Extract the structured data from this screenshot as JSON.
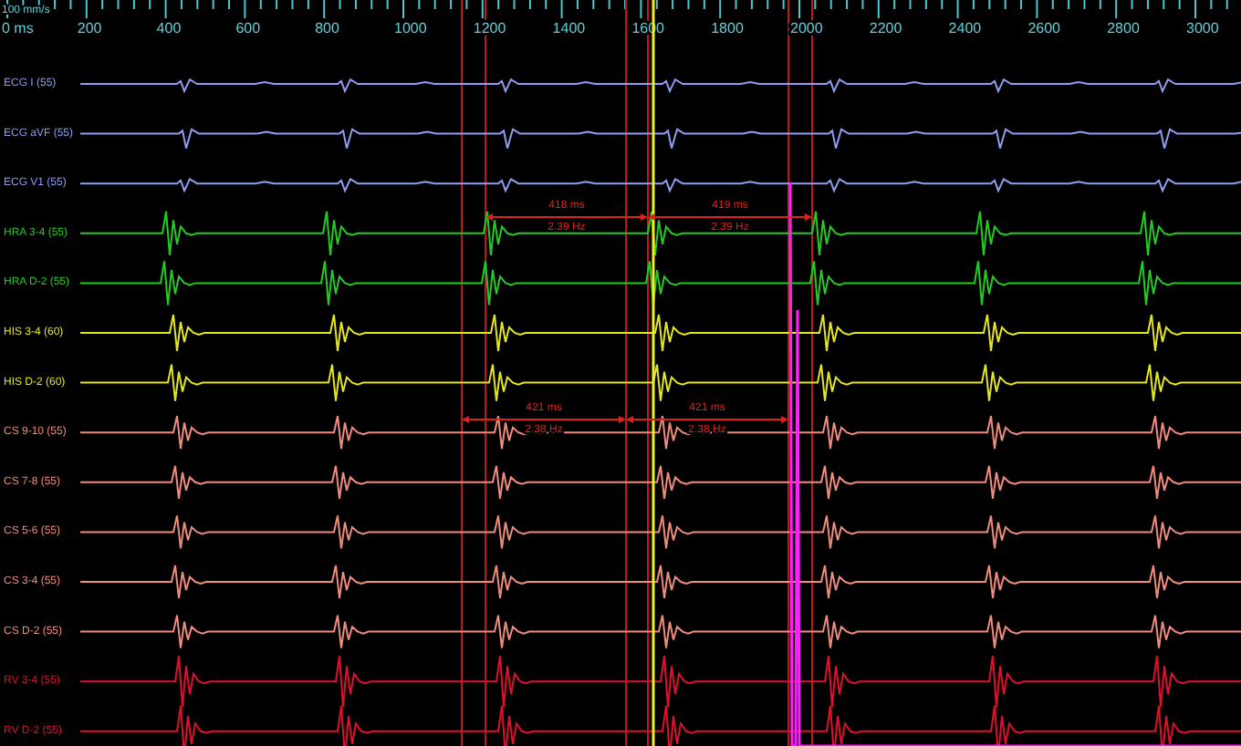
{
  "scale": "100 mm/s",
  "ruler": {
    "labels": [
      "0 ms",
      "200",
      "400",
      "600",
      "800",
      "1000",
      "1200",
      "1400",
      "1600",
      "1800",
      "2000",
      "2200",
      "2400",
      "2600",
      "2800",
      "3000"
    ]
  },
  "channels": [
    {
      "label": "ECG I (55)",
      "kind": "ecg",
      "color": "#8e9ef0"
    },
    {
      "label": "ECG aVF (55)",
      "kind": "ecg",
      "color": "#8e9ef0"
    },
    {
      "label": "ECG V1 (55)",
      "kind": "ecg",
      "color": "#8e9ef0"
    },
    {
      "label": "HRA  3-4 (55)",
      "kind": "atrial",
      "color": "#22cc22"
    },
    {
      "label": "HRA  D-2 (55)",
      "kind": "atrial",
      "color": "#22cc22"
    },
    {
      "label": "HIS  3-4 (60)",
      "kind": "his",
      "color": "#e6e620"
    },
    {
      "label": "HIS  D-2 (60)",
      "kind": "his",
      "color": "#e6e620"
    },
    {
      "label": "CS  9-10 (55)",
      "kind": "cs",
      "color": "#f08c7c"
    },
    {
      "label": "CS  7-8 (55)",
      "kind": "cs",
      "color": "#f08c7c"
    },
    {
      "label": "CS  5-6 (55)",
      "kind": "cs",
      "color": "#f08c7c"
    },
    {
      "label": "CS  3-4 (55)",
      "kind": "cs",
      "color": "#f08c7c"
    },
    {
      "label": "CS  D-2 (55)",
      "kind": "cs",
      "color": "#f08c7c"
    },
    {
      "label": "RV  3-4 (55)",
      "kind": "ventricular",
      "color": "#e0102c"
    },
    {
      "label": "RV  D-2 (55)",
      "kind": "ventricular",
      "color": "#e0102c"
    }
  ],
  "measurements": [
    {
      "interval": "418 ms",
      "rate": "2.39 Hz"
    },
    {
      "interval": "419 ms",
      "rate": "2.39 Hz"
    },
    {
      "interval": "421 ms",
      "rate": "2.38 Hz"
    },
    {
      "interval": "421 ms",
      "rate": "2.38 Hz"
    }
  ]
}
